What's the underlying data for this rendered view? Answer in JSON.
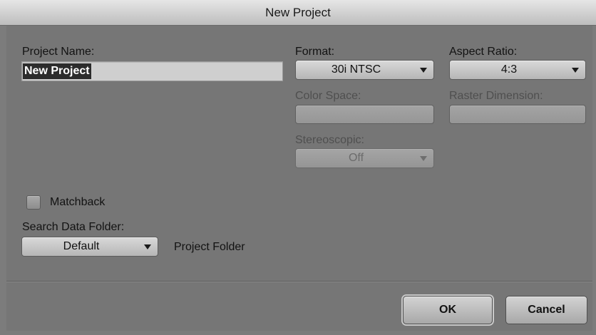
{
  "window": {
    "title": "New Project"
  },
  "project_name": {
    "label": "Project Name:",
    "value": "New Project"
  },
  "format": {
    "label": "Format:",
    "value": "30i NTSC"
  },
  "aspect_ratio": {
    "label": "Aspect Ratio:",
    "value": "4:3"
  },
  "color_space": {
    "label": "Color Space:",
    "value": ""
  },
  "raster_dimension": {
    "label": "Raster Dimension:",
    "value": ""
  },
  "stereoscopic": {
    "label": "Stereoscopic:",
    "value": "Off"
  },
  "matchback": {
    "label": "Matchback",
    "checked": false
  },
  "search_data_folder": {
    "label": "Search Data Folder:",
    "value": "Default",
    "path_label": "Project Folder"
  },
  "buttons": {
    "ok": "OK",
    "cancel": "Cancel"
  },
  "icons": {
    "dropdown": "chevron-down-icon"
  }
}
